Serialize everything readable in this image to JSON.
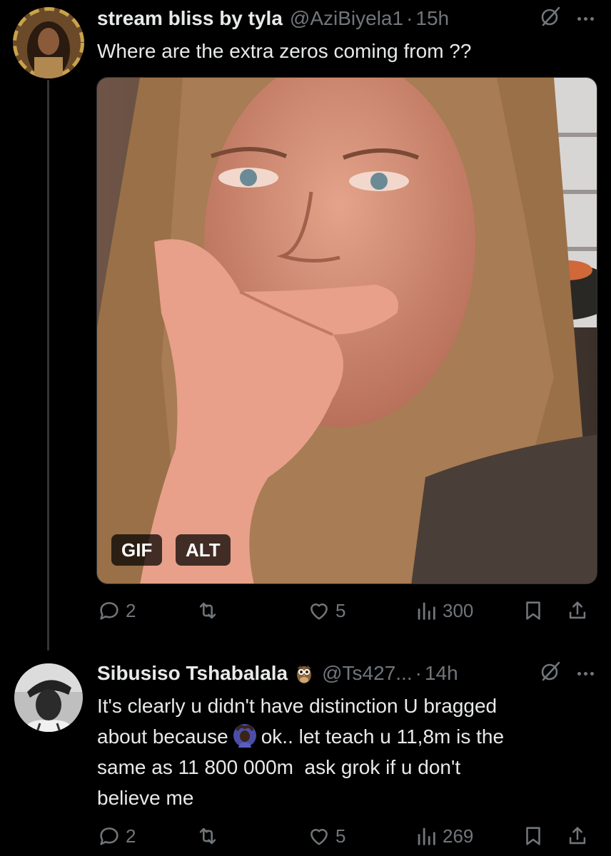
{
  "tweet1": {
    "display_name": "stream bliss by tyla",
    "handle": "@AziBiyela1",
    "separator": "·",
    "time": "15h",
    "text": "Where are the extra zeros coming from ??",
    "media_badges": {
      "gif": "GIF",
      "alt": "ALT"
    },
    "stats": {
      "replies": "2",
      "likes": "5",
      "views": "300"
    }
  },
  "tweet2": {
    "display_name": "Sibusiso Tshabalala",
    "name_emoji": "owl",
    "handle": "@Ts427...",
    "separator": "·",
    "time": "14h",
    "text_line1": "It's clearly u didn't have distinction U bragged",
    "text_line2_a": "about because",
    "text_line2_b": "ok.. let teach u 11,8m is the",
    "text_line3": "same as 11 800 000m  ask grok if u don't",
    "text_line4": "believe me",
    "inline_emoji": "person-gesturing-ok",
    "stats": {
      "replies": "2",
      "likes": "5",
      "views": "269"
    }
  },
  "icons": {
    "reply": "reply-icon",
    "retweet": "retweet-icon",
    "like": "heart-icon",
    "views": "views-icon",
    "bookmark": "bookmark-icon",
    "share": "share-icon",
    "grok": "grok-icon",
    "more": "more-icon"
  },
  "colors": {
    "background": "#000000",
    "text": "#e7e9ea",
    "muted": "#71767b",
    "divider": "#333639"
  }
}
